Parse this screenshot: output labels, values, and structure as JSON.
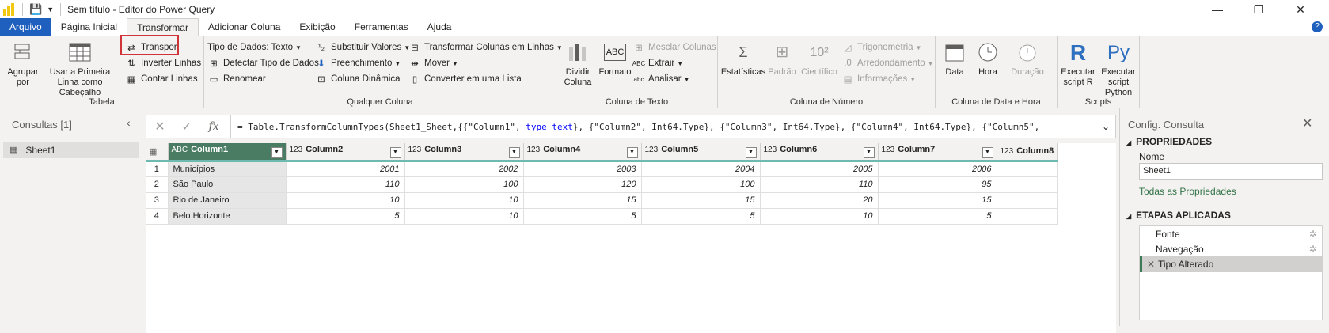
{
  "window": {
    "title": "Sem título - Editor do Power Query",
    "min": "—",
    "restore": "❐",
    "close": "✕"
  },
  "tabs": [
    "Arquivo",
    "Página Inicial",
    "Transformar",
    "Adicionar Coluna",
    "Exibição",
    "Ferramentas",
    "Ajuda"
  ],
  "ribbon": {
    "tabela": {
      "label": "Tabela",
      "agrupar": "Agrupar por",
      "usar_primeira": "Usar a Primeira Linha como Cabeçalho",
      "transpor": "Transpor",
      "inverter": "Inverter Linhas",
      "contar": "Contar Linhas"
    },
    "qualquer": {
      "label": "Qualquer Coluna",
      "tipo_dados": "Tipo de Dados: Texto",
      "detectar": "Detectar Tipo de Dados",
      "renomear": "Renomear",
      "substituir": "Substituir Valores",
      "preenchimento": "Preenchimento",
      "coluna_dinamica": "Coluna Dinâmica",
      "transformar_colunas": "Transformar Colunas em Linhas",
      "mover": "Mover",
      "converter_lista": "Converter em uma Lista"
    },
    "texto": {
      "label": "Coluna de Texto",
      "dividir": "Dividir Coluna",
      "formato": "Formato",
      "mesclar": "Mesclar Colunas",
      "extrair": "Extrair",
      "analisar": "Analisar"
    },
    "numero": {
      "label": "Coluna de Número",
      "estatisticas": "Estatísticas",
      "padrao": "Padrão",
      "cientifico": "Científico",
      "trigonometria": "Trigonometria",
      "arredondamento": "Arredondamento",
      "informacoes": "Informações"
    },
    "data": {
      "label": "Coluna de Data e Hora",
      "data": "Data",
      "hora": "Hora",
      "duracao": "Duração"
    },
    "scripts": {
      "label": "Scripts",
      "r": "Executar script R",
      "python": "Executar script Python"
    }
  },
  "queries": {
    "header": "Consultas [1]",
    "items": [
      "Sheet1"
    ]
  },
  "formula": {
    "prefix": "= Table.TransformColumnTypes(Sheet1_Sheet,{{\"Column1\", ",
    "kw": "type text",
    "suffix": "}, {\"Column2\", Int64.Type}, {\"Column3\", Int64.Type}, {\"Column4\", Int64.Type}, {\"Column5\","
  },
  "grid": {
    "columns": [
      {
        "name": "Column1",
        "type": "ABC"
      },
      {
        "name": "Column2",
        "type": "123"
      },
      {
        "name": "Column3",
        "type": "123"
      },
      {
        "name": "Column4",
        "type": "123"
      },
      {
        "name": "Column5",
        "type": "123"
      },
      {
        "name": "Column6",
        "type": "123"
      },
      {
        "name": "Column7",
        "type": "123"
      },
      {
        "name": "Column8",
        "type": "123"
      }
    ],
    "rows": [
      [
        "1",
        "Municípios",
        "2001",
        "2002",
        "2003",
        "2004",
        "2005",
        "2006",
        ""
      ],
      [
        "2",
        "São Paulo",
        "110",
        "100",
        "120",
        "100",
        "110",
        "95",
        ""
      ],
      [
        "3",
        "Rio de Janeiro",
        "10",
        "10",
        "15",
        "15",
        "20",
        "15",
        ""
      ],
      [
        "4",
        "Belo Horizonte",
        "5",
        "10",
        "5",
        "5",
        "10",
        "5",
        ""
      ]
    ]
  },
  "settings": {
    "title": "Config. Consulta",
    "propriedades": "PROPRIEDADES",
    "nome_label": "Nome",
    "nome_value": "Sheet1",
    "todas": "Todas as Propriedades",
    "etapas": "ETAPAS APLICADAS",
    "steps": [
      "Fonte",
      "Navegação",
      "Tipo Alterado"
    ]
  }
}
